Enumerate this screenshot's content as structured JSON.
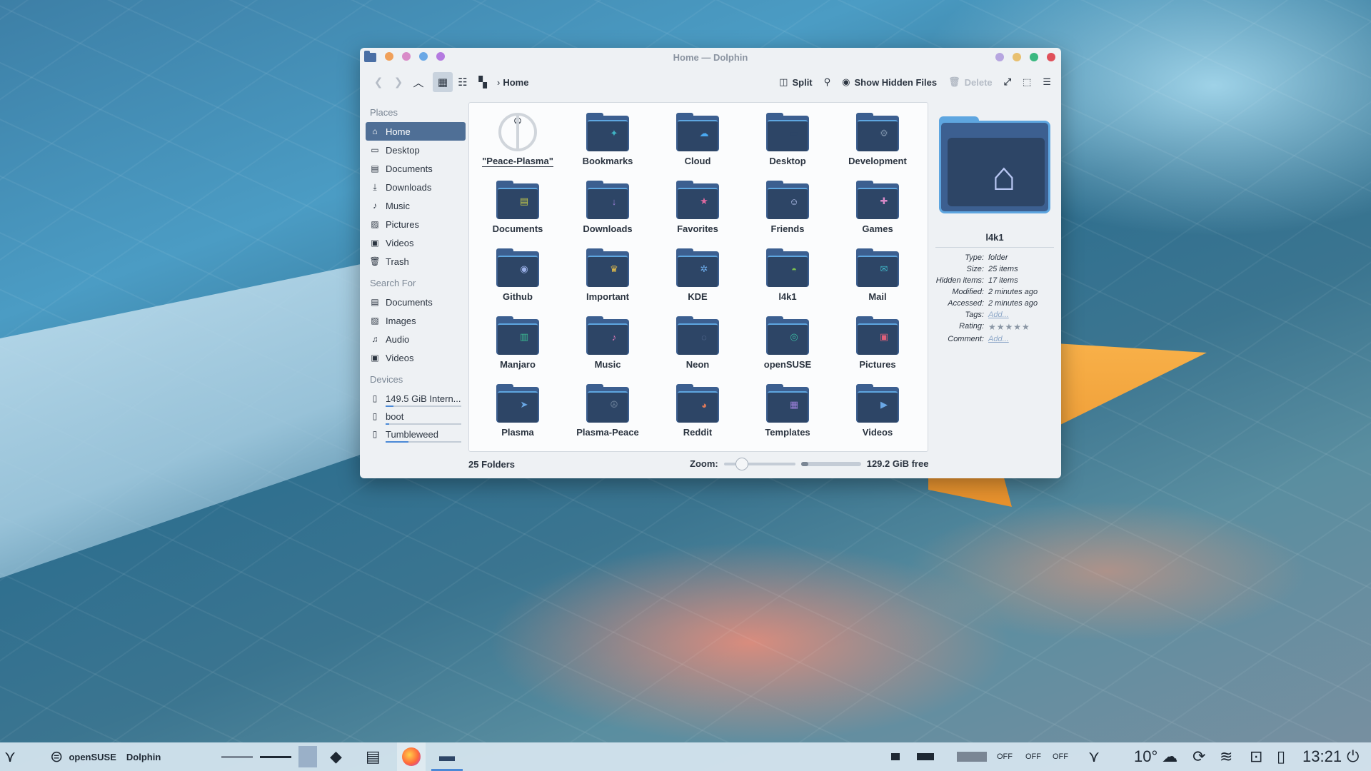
{
  "window": {
    "title": "Home — Dolphin",
    "left_dot_colors": [
      "#f0a05a",
      "#d98bc8",
      "#6aa8e6",
      "#b47ae0"
    ],
    "right_dot_colors": [
      "#b7a6e0",
      "#e8c070",
      "#3ab880",
      "#e0505a"
    ]
  },
  "toolbar": {
    "breadcrumb": "Home",
    "split_label": "Split",
    "show_hidden_label": "Show Hidden Files",
    "delete_label": "Delete"
  },
  "sidebar": {
    "places_title": "Places",
    "places": [
      {
        "label": "Home",
        "icon": "home-icon",
        "selected": true
      },
      {
        "label": "Desktop",
        "icon": "desktop-icon"
      },
      {
        "label": "Documents",
        "icon": "documents-icon"
      },
      {
        "label": "Downloads",
        "icon": "downloads-icon"
      },
      {
        "label": "Music",
        "icon": "music-icon"
      },
      {
        "label": "Pictures",
        "icon": "pictures-icon"
      },
      {
        "label": "Videos",
        "icon": "videos-icon"
      },
      {
        "label": "Trash",
        "icon": "trash-icon"
      }
    ],
    "search_title": "Search For",
    "search": [
      {
        "label": "Documents",
        "icon": "documents-icon"
      },
      {
        "label": "Images",
        "icon": "images-icon"
      },
      {
        "label": "Audio",
        "icon": "audio-icon"
      },
      {
        "label": "Videos",
        "icon": "videos-icon"
      }
    ],
    "devices_title": "Devices",
    "devices": [
      {
        "label": "149.5 GiB Intern...",
        "icon": "drive-icon",
        "usage": 0.1
      },
      {
        "label": "boot",
        "icon": "drive-icon",
        "usage": 0.05
      },
      {
        "label": "Tumbleweed",
        "icon": "drive-icon",
        "usage": 0.3
      }
    ]
  },
  "items": [
    {
      "label": "\"Peace-Plasma\"",
      "kind": "peace"
    },
    {
      "label": "Bookmarks",
      "color": "#3fb3c4",
      "glyph": "✦"
    },
    {
      "label": "Cloud",
      "color": "#4aa8f0",
      "glyph": "☁"
    },
    {
      "label": "Desktop",
      "color": "#2d4566",
      "glyph": "▭"
    },
    {
      "label": "Development",
      "color": "#7a8fa8",
      "glyph": "⚙"
    },
    {
      "label": "Documents",
      "color": "#c4c94a",
      "glyph": "▤"
    },
    {
      "label": "Downloads",
      "color": "#9a7fd8",
      "glyph": "↓"
    },
    {
      "label": "Favorites",
      "color": "#e06aa0",
      "glyph": "★"
    },
    {
      "label": "Friends",
      "color": "#b7c6f2",
      "glyph": "☺"
    },
    {
      "label": "Games",
      "color": "#d88ac8",
      "glyph": "✚"
    },
    {
      "label": "Github",
      "color": "#9ab0e8",
      "glyph": "◉"
    },
    {
      "label": "Important",
      "color": "#e8c04a",
      "glyph": "♛"
    },
    {
      "label": "KDE",
      "color": "#6aa8e6",
      "glyph": "✲"
    },
    {
      "label": "l4k1",
      "color": "#7ac050",
      "glyph": "◓"
    },
    {
      "label": "Mail",
      "color": "#3fb3c4",
      "glyph": "✉"
    },
    {
      "label": "Manjaro",
      "color": "#3ab890",
      "glyph": "▥"
    },
    {
      "label": "Music",
      "color": "#e07ab8",
      "glyph": "♪"
    },
    {
      "label": "Neon",
      "color": "#6a7fa8",
      "glyph": "◌"
    },
    {
      "label": "openSUSE",
      "color": "#3ab8a0",
      "glyph": "◎"
    },
    {
      "label": "Pictures",
      "color": "#e0607a",
      "glyph": "▣"
    },
    {
      "label": "Plasma",
      "color": "#6aa8e6",
      "glyph": "➤"
    },
    {
      "label": "Plasma-Peace",
      "color": "#6a7f98",
      "glyph": "☮"
    },
    {
      "label": "Reddit",
      "color": "#e07a5a",
      "glyph": "◕"
    },
    {
      "label": "Templates",
      "color": "#9a7fd8",
      "glyph": "▦"
    },
    {
      "label": "Videos",
      "color": "#6aa8e6",
      "glyph": "▶"
    }
  ],
  "info": {
    "name": "l4k1",
    "rows": [
      {
        "k": "Type:",
        "v": "folder"
      },
      {
        "k": "Size:",
        "v": "25 items"
      },
      {
        "k": "Hidden items:",
        "v": "17 items"
      },
      {
        "k": "Modified:",
        "v": "2 minutes ago"
      },
      {
        "k": "Accessed:",
        "v": "2 minutes ago"
      },
      {
        "k": "Tags:",
        "v": "Add...",
        "link": true
      },
      {
        "k": "Rating:",
        "v": "★★★★★",
        "stars": true
      },
      {
        "k": "Comment:",
        "v": "Add...",
        "link": true
      }
    ]
  },
  "status": {
    "count": "25 Folders",
    "zoom_label": "Zoom:",
    "zoom_level": 0.2,
    "free": "129.2 GiB free",
    "used_fraction": 0.12
  },
  "taskbar": {
    "user_label": "openSUSE",
    "app_label": "Dolphin",
    "off1": "OFF",
    "off2": "OFF",
    "off3": "OFF",
    "temp": "10°",
    "clock": "13:21"
  }
}
